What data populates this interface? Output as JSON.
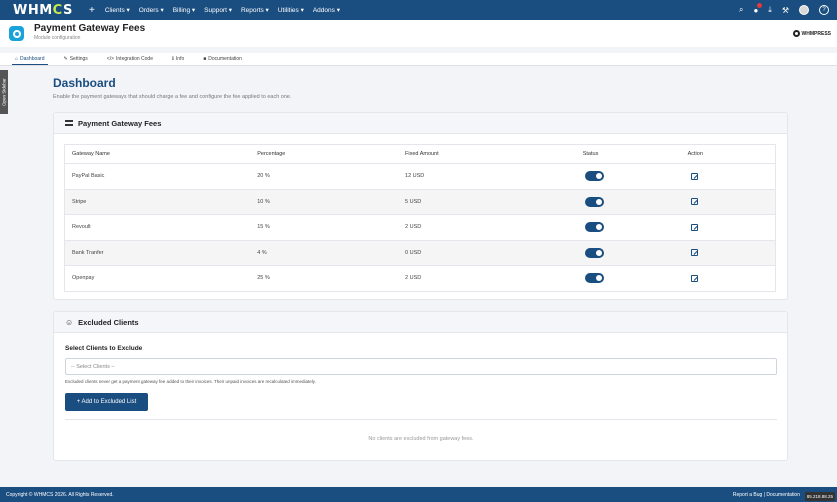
{
  "nav": {
    "logo_left": "WHM",
    "logo_o": "C",
    "logo_right": "S",
    "plus": "+",
    "menu": [
      "Clients ▾",
      "Orders ▾",
      "Billing ▾",
      "Support ▾",
      "Reports ▾",
      "Utilities ▾",
      "Addons ▾"
    ],
    "help": "?"
  },
  "module": {
    "title": "Payment Gateway Fees",
    "subtitle": "Module configuration",
    "brand": "WHMPRESS"
  },
  "tabs": [
    {
      "label": "Dashboard",
      "icon": "home-icon"
    },
    {
      "label": "Settings",
      "icon": "wrench-icon"
    },
    {
      "label": "Integration Code",
      "icon": "code-icon"
    },
    {
      "label": "Info",
      "icon": "info-icon"
    },
    {
      "label": "Documentation",
      "icon": "folder-icon"
    }
  ],
  "sidebar_toggle": "Open Sidebar",
  "page": {
    "title": "Dashboard",
    "intro": "Enable the payment gateways that should charge a fee and configure the fee applied to each one."
  },
  "fees_card": {
    "title": "Payment Gateway Fees",
    "columns": [
      "Gateway Name",
      "Percentage",
      "Fixed Amount",
      "Status",
      "Action"
    ],
    "rows": [
      {
        "name": "PayPal Basic",
        "percentage": "20 %",
        "fixed": "12 USD",
        "enabled": true
      },
      {
        "name": "Stripe",
        "percentage": "10 %",
        "fixed": "5 USD",
        "enabled": true
      },
      {
        "name": "Revoult",
        "percentage": "15 %",
        "fixed": "2 USD",
        "enabled": true
      },
      {
        "name": "Bank Tranfer",
        "percentage": "4 %",
        "fixed": "0 USD",
        "enabled": true
      },
      {
        "name": "Openpay",
        "percentage": "25 %",
        "fixed": "2 USD",
        "enabled": true
      }
    ]
  },
  "excluded_card": {
    "title": "Excluded Clients",
    "select_label": "Select Clients to Exclude",
    "select_placeholder": "-- Select Clients --",
    "help": "Excluded clients never get a payment gateway fee added to their invoices. Their unpaid invoices are recalculated immediately.",
    "add_button": "+ Add to Excluded List",
    "empty": "No clients are excluded from gateway fees."
  },
  "footer": {
    "copyright": "Copyright © WHMCS 2026. All Rights Reserved.",
    "links": "Report a Bug | Documentation",
    "ip": "85.218.88.25"
  },
  "colors": {
    "primary": "#1a4d80",
    "accent": "#c7e84a",
    "module_icon": "#1aa3d9"
  }
}
